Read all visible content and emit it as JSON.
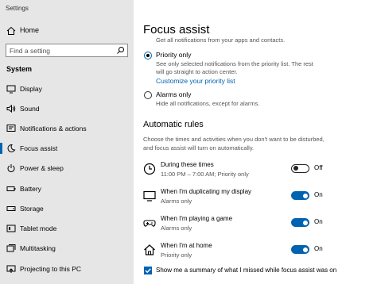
{
  "window": {
    "title": "Settings"
  },
  "sidebar": {
    "home_label": "Home",
    "search_placeholder": "Find a setting",
    "section_heading": "System",
    "items": [
      {
        "label": "Display",
        "icon": "display-icon",
        "active": false
      },
      {
        "label": "Sound",
        "icon": "sound-icon",
        "active": false
      },
      {
        "label": "Notifications & actions",
        "icon": "notifications-icon",
        "active": false
      },
      {
        "label": "Focus assist",
        "icon": "moon-icon",
        "active": true
      },
      {
        "label": "Power & sleep",
        "icon": "power-icon",
        "active": false
      },
      {
        "label": "Battery",
        "icon": "battery-icon",
        "active": false
      },
      {
        "label": "Storage",
        "icon": "storage-icon",
        "active": false
      },
      {
        "label": "Tablet mode",
        "icon": "tablet-mode-icon",
        "active": false
      },
      {
        "label": "Multitasking",
        "icon": "multitasking-icon",
        "active": false
      },
      {
        "label": "Projecting to this PC",
        "icon": "projecting-icon",
        "active": false
      }
    ]
  },
  "main": {
    "title": "Focus assist",
    "cut_off_description": "Get all notifications from your apps and contacts.",
    "options": [
      {
        "label": "Priority only",
        "selected": true,
        "description": [
          "See only selected notifications from the priority list. The rest",
          "will go straight to action center."
        ],
        "link": "Customize your priority list"
      },
      {
        "label": "Alarms only",
        "selected": false,
        "description": [
          "Hide all notifications, except for alarms."
        ]
      }
    ],
    "automatic_rules": {
      "heading": "Automatic rules",
      "description": "Choose the times and activities when you don't want to be disturbed, and focus assist will turn on automatically.",
      "rules": [
        {
          "title": "During these times",
          "detail": "11:00 PM – 7:00 AM; Priority only",
          "on": false,
          "state": "Off",
          "icon": "clock-icon"
        },
        {
          "title": "When I'm duplicating my display",
          "detail": "Alarms only",
          "on": true,
          "state": "On",
          "icon": "monitor-icon"
        },
        {
          "title": "When I'm playing a game",
          "detail": "Alarms only",
          "on": true,
          "state": "On",
          "icon": "gamepad-icon"
        },
        {
          "title": "When I'm at home",
          "detail": "Priority only",
          "on": true,
          "state": "On",
          "icon": "house-icon"
        }
      ]
    },
    "summary_checkbox": {
      "label": "Show me a summary of what I missed while focus assist was on",
      "checked": true
    }
  },
  "colors": {
    "accent": "#0063b1",
    "sidebar_bg": "#e6e6e6"
  }
}
